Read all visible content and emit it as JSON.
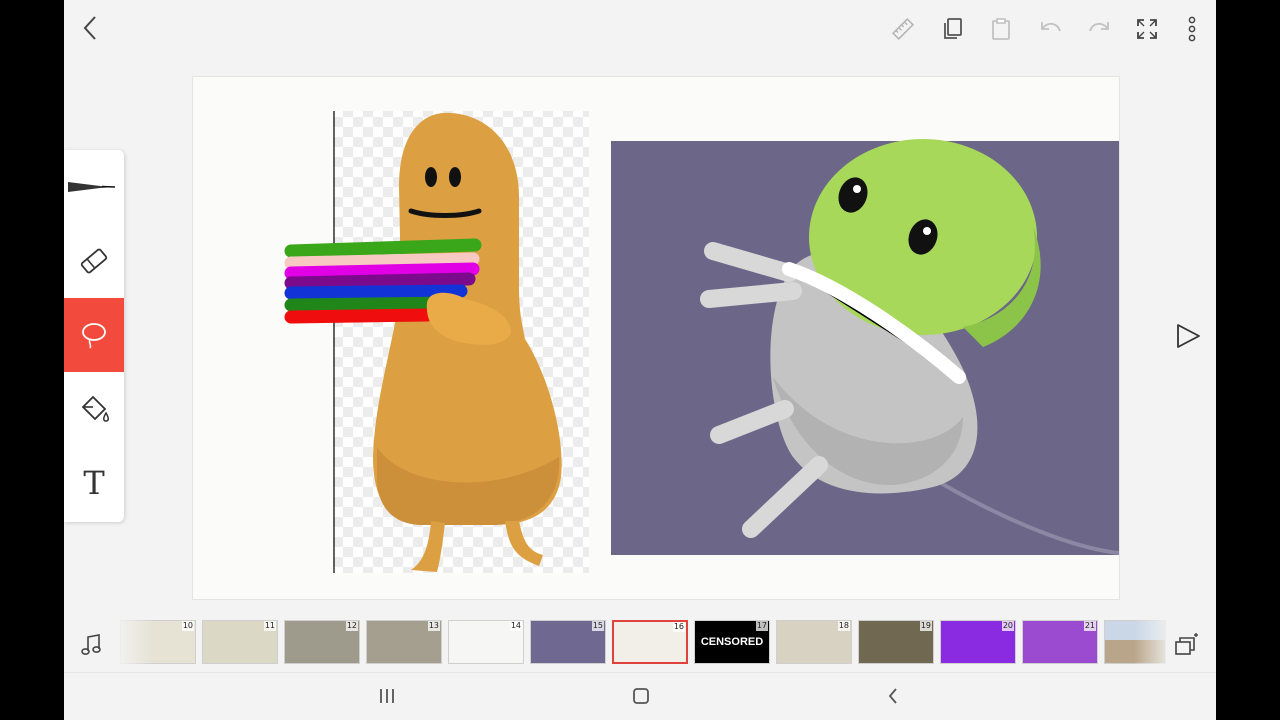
{
  "toolbar": {
    "back": "back-icon",
    "actions": [
      "ruler-icon",
      "copy-icon",
      "paste-icon",
      "undo-icon",
      "redo-icon",
      "fullscreen-icon",
      "more-vertical-icon"
    ]
  },
  "tools": [
    "pen-icon",
    "eraser-icon",
    "lasso-icon",
    "fill-bucket-icon",
    "text-tool-icon"
  ],
  "tools_active": "lasso-icon",
  "tool_glyphs": {
    "text": "T"
  },
  "colors": {
    "accent": "#f24a3c",
    "background": "#f2f3f2",
    "canvas": "#fbfbf9"
  },
  "frames": [
    {
      "num": "10",
      "bg": "#e6e2d4"
    },
    {
      "num": "11",
      "bg": "#dcd8c6"
    },
    {
      "num": "12",
      "bg": "#9e9a8c"
    },
    {
      "num": "13",
      "bg": "#a49f8e"
    },
    {
      "num": "14",
      "bg": "#f6f6f4"
    },
    {
      "num": "15",
      "bg": "#6f6890"
    },
    {
      "num": "16",
      "bg": "#f2eee8",
      "selected": true
    },
    {
      "num": "17",
      "bg": "#000000",
      "text": "CENSORED"
    },
    {
      "num": "18",
      "bg": "#d8d2c2"
    },
    {
      "num": "19",
      "bg": "#706850"
    },
    {
      "num": "20",
      "bg": "#8a2be2"
    },
    {
      "num": "21",
      "bg": "#9a4bd0"
    }
  ],
  "timeline": {
    "music": "music-note-icon",
    "layers": "layers-icon"
  },
  "nav": [
    "recent-apps-icon",
    "home-icon",
    "back-nav-icon"
  ]
}
